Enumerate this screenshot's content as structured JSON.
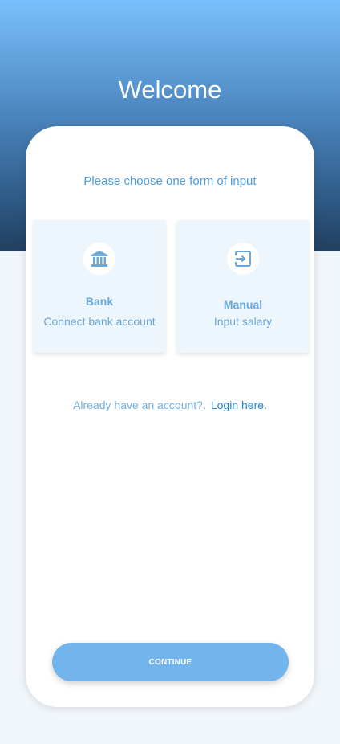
{
  "header": {
    "title": "Welcome"
  },
  "card": {
    "prompt": "Please choose one form of input",
    "options": [
      {
        "icon": "bank-icon",
        "title": "Bank",
        "subtitle": "Connect bank account"
      },
      {
        "icon": "input-icon",
        "title": "Manual",
        "subtitle": "Input salary"
      }
    ],
    "account_text": "Already have an account?.",
    "login_link": "Login here.",
    "continue_label": "CONTINUE"
  },
  "colors": {
    "accent": "#72b5ed",
    "link": "#1e86d8",
    "hero_top": "#78c0fd",
    "hero_bottom": "#223f5e"
  }
}
